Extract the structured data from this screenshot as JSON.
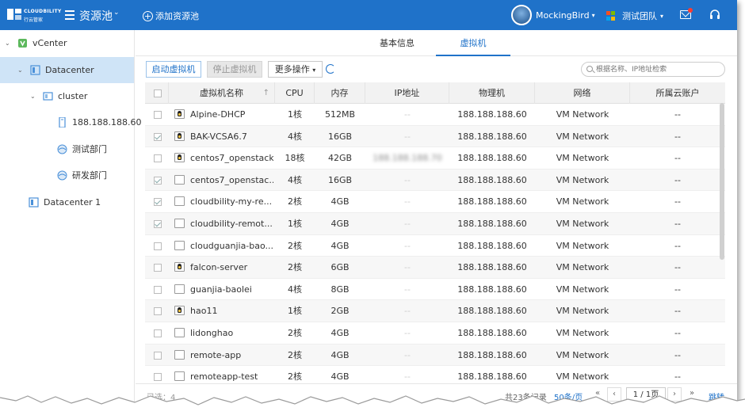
{
  "header": {
    "brand": "CLOUDBILITY",
    "brand_sub": "行云管家",
    "title": "资源池",
    "add_pool": "添加资源池",
    "user_name": "MockingBird",
    "team": "测试团队"
  },
  "sidebar": {
    "items": [
      {
        "label": "vCenter"
      },
      {
        "label": "Datacenter"
      },
      {
        "label": "cluster"
      },
      {
        "label": "188.188.188.60"
      },
      {
        "label": "测试部门"
      },
      {
        "label": "研发部门"
      },
      {
        "label": "Datacenter 1"
      }
    ]
  },
  "tabs": [
    {
      "label": "基本信息"
    },
    {
      "label": "虚拟机"
    }
  ],
  "toolbar": {
    "start": "启动虚拟机",
    "stop": "停止虚拟机",
    "more": "更多操作",
    "search_placeholder": "根据名称、IP地址检索"
  },
  "table": {
    "columns": [
      "虚拟机名称",
      "CPU",
      "内存",
      "IP地址",
      "物理机",
      "网络",
      "所属云账户"
    ],
    "rows": [
      {
        "name": "Alpine-DHCP",
        "cpu": "1核",
        "mem": "512MB",
        "ip": "--",
        "host": "188.188.188.60",
        "net": "VM Network",
        "account": "--",
        "checked": false,
        "linux": true
      },
      {
        "name": "BAK-VCSA6.7",
        "cpu": "4核",
        "mem": "16GB",
        "ip": "--",
        "host": "188.188.188.60",
        "net": "VM Network",
        "account": "--",
        "checked": true,
        "linux": true
      },
      {
        "name": "centos7_openstack",
        "cpu": "18核",
        "mem": "42GB",
        "ip": "188.188.188.70",
        "host": "188.188.188.60",
        "net": "VM Network",
        "account": "--",
        "checked": false,
        "linux": true
      },
      {
        "name": "centos7_openstac...",
        "cpu": "4核",
        "mem": "16GB",
        "ip": "--",
        "host": "188.188.188.60",
        "net": "VM Network",
        "account": "--",
        "checked": true,
        "linux": false
      },
      {
        "name": "cloudbility-my-re...",
        "cpu": "2核",
        "mem": "4GB",
        "ip": "--",
        "host": "188.188.188.60",
        "net": "VM Network",
        "account": "--",
        "checked": true,
        "linux": false
      },
      {
        "name": "cloudbility-remot...",
        "cpu": "1核",
        "mem": "4GB",
        "ip": "--",
        "host": "188.188.188.60",
        "net": "VM Network",
        "account": "--",
        "checked": true,
        "linux": false
      },
      {
        "name": "cloudguanjia-bao...",
        "cpu": "2核",
        "mem": "4GB",
        "ip": "--",
        "host": "188.188.188.60",
        "net": "VM Network",
        "account": "--",
        "checked": false,
        "linux": false
      },
      {
        "name": "falcon-server",
        "cpu": "2核",
        "mem": "6GB",
        "ip": "--",
        "host": "188.188.188.60",
        "net": "VM Network",
        "account": "--",
        "checked": false,
        "linux": true
      },
      {
        "name": "guanjia-baolei",
        "cpu": "4核",
        "mem": "8GB",
        "ip": "--",
        "host": "188.188.188.60",
        "net": "VM Network",
        "account": "--",
        "checked": false,
        "linux": false
      },
      {
        "name": "hao11",
        "cpu": "1核",
        "mem": "2GB",
        "ip": "--",
        "host": "188.188.188.60",
        "net": "VM Network",
        "account": "--",
        "checked": false,
        "linux": true
      },
      {
        "name": "lidonghao",
        "cpu": "2核",
        "mem": "4GB",
        "ip": "--",
        "host": "188.188.188.60",
        "net": "VM Network",
        "account": "--",
        "checked": false,
        "linux": false
      },
      {
        "name": "remote-app",
        "cpu": "2核",
        "mem": "4GB",
        "ip": "--",
        "host": "188.188.188.60",
        "net": "VM Network",
        "account": "--",
        "checked": false,
        "linux": false
      },
      {
        "name": "remoteapp-test",
        "cpu": "2核",
        "mem": "4GB",
        "ip": "--",
        "host": "188.188.188.60",
        "net": "VM Network",
        "account": "--",
        "checked": false,
        "linux": false
      }
    ]
  },
  "footer": {
    "selected": "已选：4",
    "total": "共23条记录",
    "page_size": "50条/页",
    "page": "1 / 1页",
    "jump": "跳转"
  },
  "colors": {
    "header_bg": "#1f72c9",
    "accent": "#1f72c9",
    "selected_tree": "#cfe4f7"
  }
}
